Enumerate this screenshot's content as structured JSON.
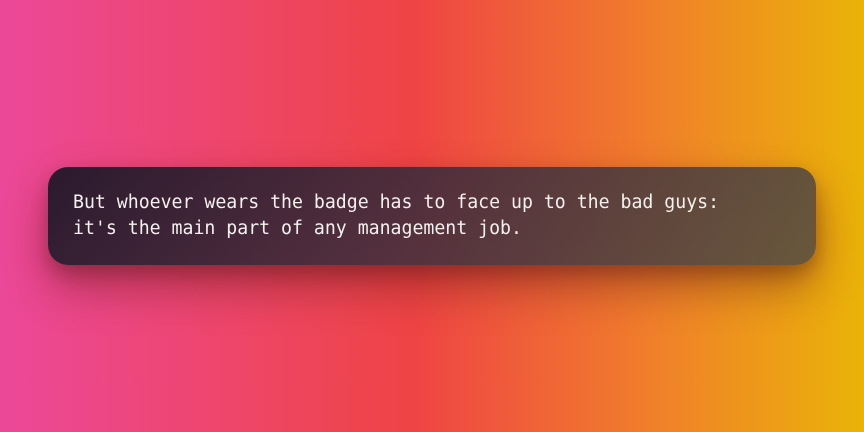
{
  "quote": {
    "lines": [
      "But whoever wears the badge has to face up to the bad guys:",
      "it's the main part of any management job."
    ]
  },
  "colors": {
    "gradient_left": "#ec4899",
    "gradient_middle": "#ef4444",
    "gradient_right": "#eab308",
    "card_background": "#2a2332",
    "text": "#f4f1ee"
  }
}
